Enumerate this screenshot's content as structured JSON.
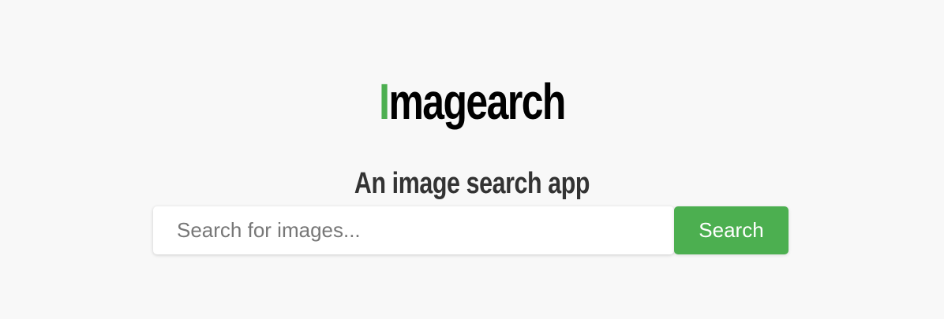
{
  "logo": {
    "first_letter": "I",
    "rest": "magearch",
    "accent_color": "#4caf50"
  },
  "tagline": "An image search app",
  "search": {
    "placeholder": "Search for images...",
    "value": "",
    "button_label": "Search",
    "button_color": "#4caf50"
  }
}
